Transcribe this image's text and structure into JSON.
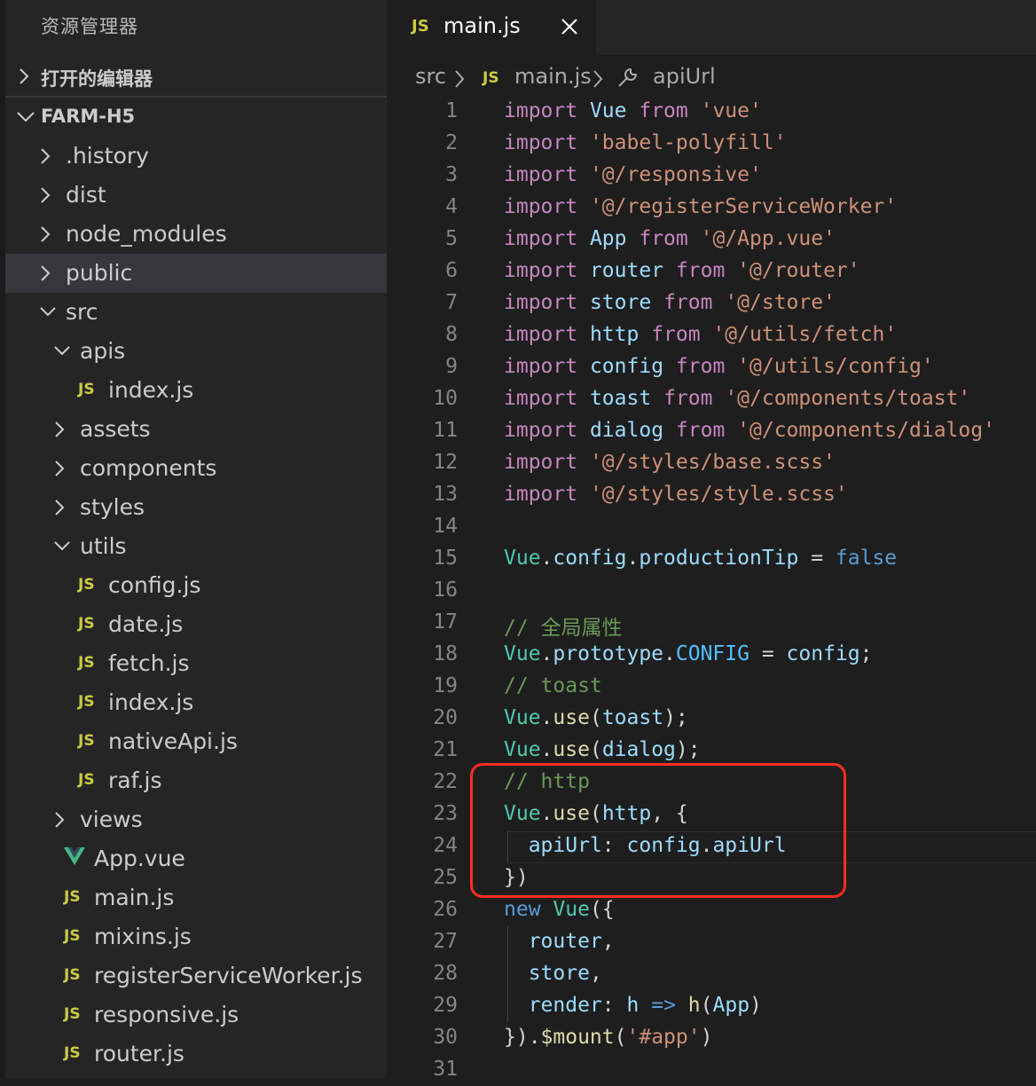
{
  "sidebar": {
    "title": "资源管理器",
    "open_editors_label": "打开的编辑器",
    "project_label": "FARM-H5",
    "tree": [
      {
        "name": ".history",
        "type": "folder",
        "expanded": false,
        "depth": 0
      },
      {
        "name": "dist",
        "type": "folder",
        "expanded": false,
        "depth": 0
      },
      {
        "name": "node_modules",
        "type": "folder",
        "expanded": false,
        "depth": 0
      },
      {
        "name": "public",
        "type": "folder",
        "expanded": false,
        "depth": 0,
        "selected": true
      },
      {
        "name": "src",
        "type": "folder",
        "expanded": true,
        "depth": 0
      },
      {
        "name": "apis",
        "type": "folder",
        "expanded": true,
        "depth": 1
      },
      {
        "name": "index.js",
        "type": "js",
        "depth": 2
      },
      {
        "name": "assets",
        "type": "folder",
        "expanded": false,
        "depth": 1
      },
      {
        "name": "components",
        "type": "folder",
        "expanded": false,
        "depth": 1
      },
      {
        "name": "styles",
        "type": "folder",
        "expanded": false,
        "depth": 1
      },
      {
        "name": "utils",
        "type": "folder",
        "expanded": true,
        "depth": 1
      },
      {
        "name": "config.js",
        "type": "js",
        "depth": 2
      },
      {
        "name": "date.js",
        "type": "js",
        "depth": 2
      },
      {
        "name": "fetch.js",
        "type": "js",
        "depth": 2
      },
      {
        "name": "index.js",
        "type": "js",
        "depth": 2
      },
      {
        "name": "nativeApi.js",
        "type": "js",
        "depth": 2
      },
      {
        "name": "raf.js",
        "type": "js",
        "depth": 2
      },
      {
        "name": "views",
        "type": "folder",
        "expanded": false,
        "depth": 1
      },
      {
        "name": "App.vue",
        "type": "vue",
        "depth": 1
      },
      {
        "name": "main.js",
        "type": "js",
        "depth": 1
      },
      {
        "name": "mixins.js",
        "type": "js",
        "depth": 1
      },
      {
        "name": "registerServiceWorker.js",
        "type": "js",
        "depth": 1
      },
      {
        "name": "responsive.js",
        "type": "js",
        "depth": 1
      },
      {
        "name": "router.js",
        "type": "js",
        "depth": 1
      }
    ],
    "js_badge": "JS"
  },
  "tab": {
    "label": "main.js",
    "icon": "js-file-icon"
  },
  "breadcrumb": {
    "items": [
      "src",
      "main.js",
      "apiUrl"
    ]
  },
  "code": {
    "lines": [
      [
        {
          "t": "import",
          "c": "kw"
        },
        {
          "t": " "
        },
        {
          "t": "Vue",
          "c": "id"
        },
        {
          "t": " "
        },
        {
          "t": "from",
          "c": "kw"
        },
        {
          "t": " "
        },
        {
          "t": "'vue'",
          "c": "str"
        }
      ],
      [
        {
          "t": "import",
          "c": "kw"
        },
        {
          "t": " "
        },
        {
          "t": "'babel-polyfill'",
          "c": "str"
        }
      ],
      [
        {
          "t": "import",
          "c": "kw"
        },
        {
          "t": " "
        },
        {
          "t": "'@/responsive'",
          "c": "str"
        }
      ],
      [
        {
          "t": "import",
          "c": "kw"
        },
        {
          "t": " "
        },
        {
          "t": "'@/registerServiceWorker'",
          "c": "str"
        }
      ],
      [
        {
          "t": "import",
          "c": "kw"
        },
        {
          "t": " "
        },
        {
          "t": "App",
          "c": "id"
        },
        {
          "t": " "
        },
        {
          "t": "from",
          "c": "kw"
        },
        {
          "t": " "
        },
        {
          "t": "'@/App.vue'",
          "c": "str"
        }
      ],
      [
        {
          "t": "import",
          "c": "kw"
        },
        {
          "t": " "
        },
        {
          "t": "router",
          "c": "id"
        },
        {
          "t": " "
        },
        {
          "t": "from",
          "c": "kw"
        },
        {
          "t": " "
        },
        {
          "t": "'@/router'",
          "c": "str"
        }
      ],
      [
        {
          "t": "import",
          "c": "kw"
        },
        {
          "t": " "
        },
        {
          "t": "store",
          "c": "id"
        },
        {
          "t": " "
        },
        {
          "t": "from",
          "c": "kw"
        },
        {
          "t": " "
        },
        {
          "t": "'@/store'",
          "c": "str"
        }
      ],
      [
        {
          "t": "import",
          "c": "kw"
        },
        {
          "t": " "
        },
        {
          "t": "http",
          "c": "id"
        },
        {
          "t": " "
        },
        {
          "t": "from",
          "c": "kw"
        },
        {
          "t": " "
        },
        {
          "t": "'@/utils/fetch'",
          "c": "str"
        }
      ],
      [
        {
          "t": "import",
          "c": "kw"
        },
        {
          "t": " "
        },
        {
          "t": "config",
          "c": "id"
        },
        {
          "t": " "
        },
        {
          "t": "from",
          "c": "kw"
        },
        {
          "t": " "
        },
        {
          "t": "'@/utils/config'",
          "c": "str"
        }
      ],
      [
        {
          "t": "import",
          "c": "kw"
        },
        {
          "t": " "
        },
        {
          "t": "toast",
          "c": "id"
        },
        {
          "t": " "
        },
        {
          "t": "from",
          "c": "kw"
        },
        {
          "t": " "
        },
        {
          "t": "'@/components/toast'",
          "c": "str"
        }
      ],
      [
        {
          "t": "import",
          "c": "kw"
        },
        {
          "t": " "
        },
        {
          "t": "dialog",
          "c": "id"
        },
        {
          "t": " "
        },
        {
          "t": "from",
          "c": "kw"
        },
        {
          "t": " "
        },
        {
          "t": "'@/components/dialog'",
          "c": "str"
        }
      ],
      [
        {
          "t": "import",
          "c": "kw"
        },
        {
          "t": " "
        },
        {
          "t": "'@/styles/base.scss'",
          "c": "str"
        }
      ],
      [
        {
          "t": "import",
          "c": "kw"
        },
        {
          "t": " "
        },
        {
          "t": "'@/styles/style.scss'",
          "c": "str"
        }
      ],
      [],
      [
        {
          "t": "Vue",
          "c": "cls"
        },
        {
          "t": "."
        },
        {
          "t": "config",
          "c": "id"
        },
        {
          "t": "."
        },
        {
          "t": "productionTip",
          "c": "id"
        },
        {
          "t": " = "
        },
        {
          "t": "false",
          "c": "bool"
        }
      ],
      [],
      [
        {
          "t": "// 全局属性",
          "c": "cmt"
        }
      ],
      [
        {
          "t": "Vue",
          "c": "cls"
        },
        {
          "t": "."
        },
        {
          "t": "prototype",
          "c": "id"
        },
        {
          "t": "."
        },
        {
          "t": "CONFIG",
          "c": "const"
        },
        {
          "t": " = "
        },
        {
          "t": "config",
          "c": "id"
        },
        {
          "t": ";"
        }
      ],
      [
        {
          "t": "// toast",
          "c": "cmt"
        }
      ],
      [
        {
          "t": "Vue",
          "c": "cls"
        },
        {
          "t": "."
        },
        {
          "t": "use",
          "c": "fn"
        },
        {
          "t": "("
        },
        {
          "t": "toast",
          "c": "id"
        },
        {
          "t": ");"
        }
      ],
      [
        {
          "t": "Vue",
          "c": "cls"
        },
        {
          "t": "."
        },
        {
          "t": "use",
          "c": "fn"
        },
        {
          "t": "("
        },
        {
          "t": "dialog",
          "c": "id"
        },
        {
          "t": ");"
        }
      ],
      [
        {
          "t": "// http",
          "c": "cmt"
        }
      ],
      [
        {
          "t": "Vue",
          "c": "cls"
        },
        {
          "t": "."
        },
        {
          "t": "use",
          "c": "fn"
        },
        {
          "t": "("
        },
        {
          "t": "http",
          "c": "id"
        },
        {
          "t": ", {"
        }
      ],
      [
        {
          "t": "  "
        },
        {
          "t": "apiUrl",
          "c": "id"
        },
        {
          "t": ": "
        },
        {
          "t": "config",
          "c": "id"
        },
        {
          "t": "."
        },
        {
          "t": "apiUrl",
          "c": "id"
        }
      ],
      [
        {
          "t": "})"
        }
      ],
      [
        {
          "t": "new",
          "c": "bool"
        },
        {
          "t": " "
        },
        {
          "t": "Vue",
          "c": "cls"
        },
        {
          "t": "({"
        }
      ],
      [
        {
          "t": "  "
        },
        {
          "t": "router",
          "c": "id"
        },
        {
          "t": ","
        }
      ],
      [
        {
          "t": "  "
        },
        {
          "t": "store",
          "c": "id"
        },
        {
          "t": ","
        }
      ],
      [
        {
          "t": "  "
        },
        {
          "t": "render",
          "c": "id"
        },
        {
          "t": ": "
        },
        {
          "t": "h",
          "c": "id"
        },
        {
          "t": " "
        },
        {
          "t": "=>",
          "c": "bool"
        },
        {
          "t": " "
        },
        {
          "t": "h",
          "c": "fn"
        },
        {
          "t": "("
        },
        {
          "t": "App",
          "c": "id"
        },
        {
          "t": ")"
        }
      ],
      [
        {
          "t": "})."
        },
        {
          "t": "$mount",
          "c": "fn"
        },
        {
          "t": "("
        },
        {
          "t": "'#app'",
          "c": "str"
        },
        {
          "t": ")"
        }
      ],
      []
    ]
  },
  "colors": {
    "keyword": "#c586c0",
    "identifier": "#9cdcfe",
    "string": "#ce9178",
    "comment": "#6a9955",
    "highlight_box": "#ff2d20"
  }
}
